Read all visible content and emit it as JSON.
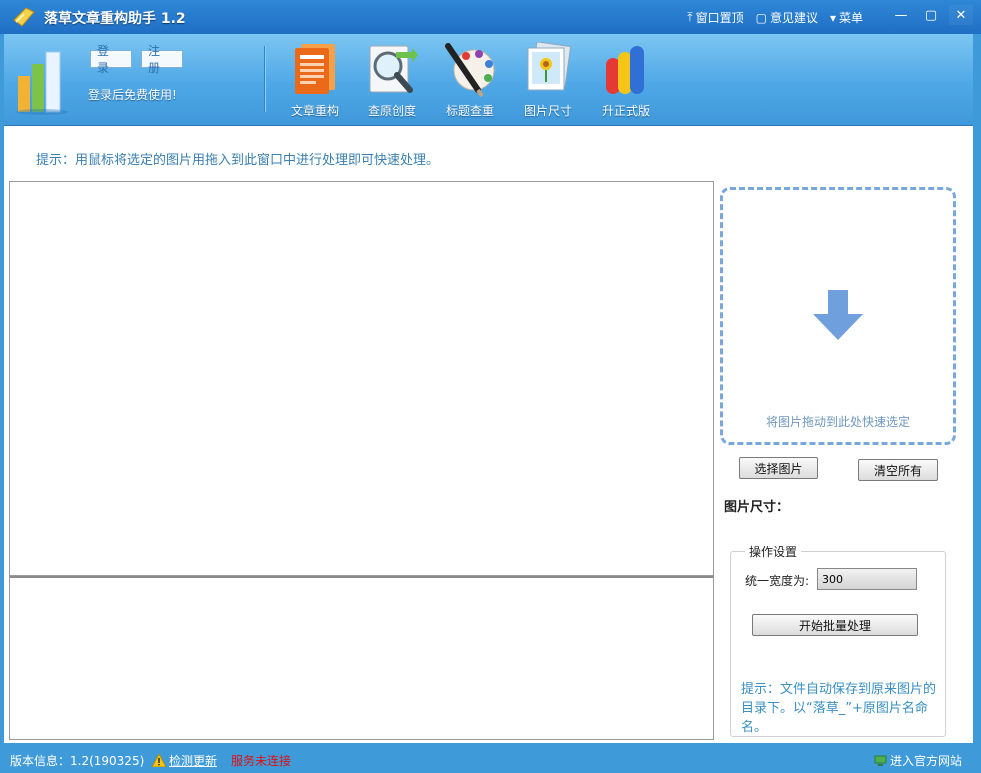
{
  "window": {
    "title": "落草文章重构助手 1.2",
    "links": [
      "窗口置顶",
      "意见建议",
      "菜单"
    ],
    "controls": [
      "minimize",
      "maximize",
      "close"
    ]
  },
  "account": {
    "login_label": "登录",
    "register_label": "注册",
    "note": "登录后免费使用!"
  },
  "tools": [
    {
      "label": "文章重构",
      "icon": "article-icon"
    },
    {
      "label": "查原创度",
      "icon": "magnifier-icon"
    },
    {
      "label": "标题查重",
      "icon": "pen-palette-icon"
    },
    {
      "label": "图片尺寸",
      "icon": "picture-icon"
    },
    {
      "label": "升正式版",
      "icon": "upgrade-bars-icon"
    }
  ],
  "hint": "提示：用鼠标将选定的图片用拖入到此窗口中进行处理即可快速处理。",
  "dropzone": {
    "text": "将图片拖动到此处快速选定"
  },
  "buttons": {
    "select": "选择图片",
    "clear": "清空所有",
    "start": "开始批量处理"
  },
  "size_label": "图片尺寸：",
  "settings": {
    "title": "操作设置",
    "width_label": "统一宽度为:",
    "width_value": "300",
    "tip": "提示：文件自动保存到原来图片的目录下。以“落草_”+原图片名命名。"
  },
  "status": {
    "version": "版本信息：1.2(190325)",
    "check_update": "检测更新",
    "service": "服务未连接",
    "official_site": "进入官方网站"
  },
  "colors": {
    "accent": "#2f87d6",
    "toolbar": "#4fa8e6",
    "hint_text": "#3a7fb0",
    "warning": "#d11111"
  }
}
